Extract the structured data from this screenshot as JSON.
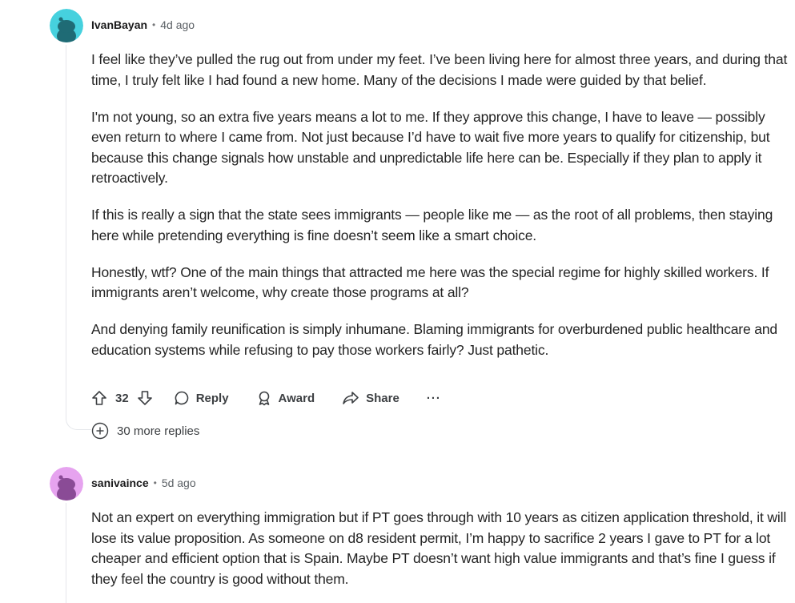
{
  "comments": [
    {
      "author": "IvanBayan",
      "separator": "•",
      "time": "4d ago",
      "paragraphs": [
        "I feel like they’ve pulled the rug out from under my feet. I’ve been living here for almost three years, and during that time, I truly felt like I had found a new home. Many of the decisions I made were guided by that belief.",
        "I'm not young, so an extra five years means a lot to me. If they approve this change, I have to leave — possibly even return to where I came from. Not just because I’d have to wait five more years to qualify for citizenship, but because this change signals how unstable and unpredictable life here can be. Especially if they plan to apply it retroactively.",
        "If this is really a sign that the state sees immigrants — people like me — as the root of all problems, then staying here while pretending everything is fine doesn’t seem like a smart choice.",
        "Honestly, wtf? One of the main things that attracted me here was the special regime for highly skilled workers. If immigrants aren’t welcome, why create those programs at all?",
        "And denying family reunification is simply inhumane. Blaming immigrants for overburdened public healthcare and education systems while refusing to pay those workers fairly? Just pathetic."
      ],
      "score": "32",
      "reply_label": "Reply",
      "award_label": "Award",
      "share_label": "Share",
      "more_label": "···",
      "more_replies": "30 more replies",
      "avatar_color": "#46d1de"
    },
    {
      "author": "sanivaince",
      "separator": "•",
      "time": "5d ago",
      "paragraphs": [
        "Not an expert on everything immigration but if PT goes through with 10 years as citizen application threshold, it will lose its value proposition. As someone on d8 resident permit, I’m happy to sacrifice 2 years I gave to PT for a lot cheaper and efficient option that is Spain. Maybe PT doesn’t want high value immigrants and that’s fine I guess if they feel the country is good without them."
      ],
      "avatar_color": "#e6a3ef"
    }
  ],
  "icons": {
    "upvote": "upvote-icon",
    "downvote": "downvote-icon",
    "reply": "comment-bubble-icon",
    "award": "award-icon",
    "share": "share-icon",
    "more": "overflow-menu-icon",
    "expand": "plus-circle-icon"
  },
  "colors": {
    "text": "#242424",
    "muted": "#5c6166",
    "thread_line": "#e5e7eb"
  }
}
